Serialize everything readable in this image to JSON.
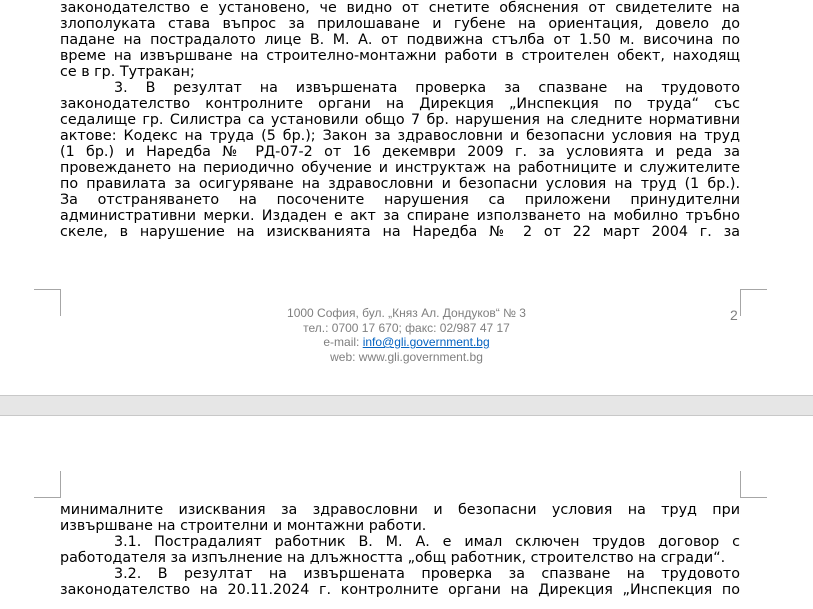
{
  "page1": {
    "lines": [
      "законодателство е установено, че видно от снетите обяснения от свидетелите на",
      "злополуката става въпрос за прилошаване и губене на ориентация, довело до",
      "падане на пострадалото лице В. М. А. от подвижна стълба от 1.50 м. височина по",
      "време на извършване на строително-монтажни работи в строителен обект, находящ",
      "се в гр. Тутракан;",
      "3. В резултат на извършената проверка за спазване на трудовото",
      "законодателство контролните органи на Дирекция „Инспекция по труда“ със",
      "седалище гр. Силистра са установили общо 7 бр. нарушения на следните нормативни",
      "актове: Кодекс на труда (5 бр.); Закон за здравословни и безопасни условия на труд",
      "(1 бр.) и Наредба № РД-07-2 от 16 декември 2009 г. за условията и реда за",
      "провеждането на периодично обучение и инструктаж на работниците и служителите",
      "по правилата за осигуряване на здравословни и безопасни условия на труд (1 бр.).",
      "За отстраняването на посочените нарушения са приложени принудителни",
      "административни мерки. Издаден е акт за спиране използването на мобилно тръбно",
      "скеле, в нарушение на изискванията на Наредба № 2 от 22 март 2004 г. за"
    ]
  },
  "footer": {
    "address": "1000 София, бул. „Княз Ал. Дондуков“ № 3",
    "phone": "тел.: 0700 17 670; факс: 02/987 47 17",
    "email_label": "e-mail: ",
    "email": "info@gli.government.bg",
    "web": "web: www.gli.government.bg",
    "page_number": "2"
  },
  "page2": {
    "lines": [
      "минималните изисквания за здравословни и безопасни условия на труд при",
      "извършване на строителни и монтажни работи.",
      "3.1. Пострадалият работник В. М. А. е имал сключен трудов договор с",
      "работодателя за изпълнение на длъжността „общ работник, строителство на сгради“.",
      "3.2. В резултат на извършената проверка за спазване на трудовото",
      "законодателство на 20.11.2024 г. контролните органи на Дирекция „Инспекция по"
    ]
  }
}
